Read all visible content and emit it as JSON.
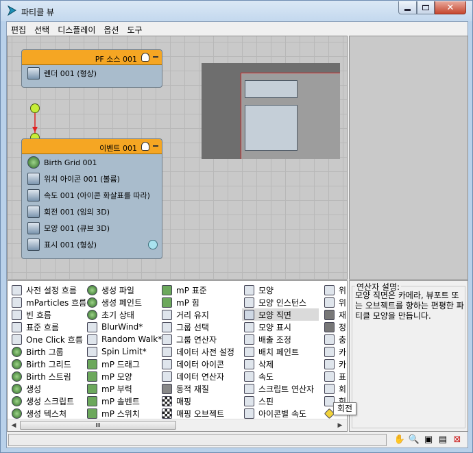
{
  "window": {
    "title": "파티클 뷰"
  },
  "menubar": [
    "편집",
    "선택",
    "디스플레이",
    "옵션",
    "도구"
  ],
  "nodes": [
    {
      "title": "PF 소스 001",
      "rows": [
        "렌더 001 (형상)"
      ]
    },
    {
      "title": "이벤트 001",
      "rows": [
        "Birth Grid 001",
        "위치 아이콘 001 (볼륨)",
        "속도 001 (아이콘 화살표를 따라)",
        "회전 001 (임의 3D)",
        "모양 001 (큐브 3D)",
        "표시 001 (형상)"
      ]
    }
  ],
  "depot": {
    "columns": [
      [
        "사전 설정 흐름",
        "mParticles 흐름",
        "빈 흐름",
        "표준 흐름",
        "One Click 흐름",
        "Birth 그룹",
        "Birth 그리드",
        "Birth 스트림",
        "생성",
        "생성 스크립트",
        "생성 텍스처"
      ],
      [
        "생성 파일",
        "생성 페인트",
        "초기 상태",
        "BlurWind*",
        "Random Walk*",
        "Spin Limit*",
        "mP 드래그",
        "mP 모양",
        "mP 부력",
        "mP 솔벤트",
        "mP 스위치"
      ],
      [
        "mP 표준",
        "mP 힘",
        "거리 유지",
        "그룹 선택",
        "그룹 연산자",
        "데이터 사전 설정",
        "데이터 아이콘",
        "데이터 연산자",
        "동적 재질",
        "매핑",
        "매핑 오브젝트"
      ],
      [
        "모양",
        "모양 인스턴스",
        "모양 직면",
        "모양 표시",
        "배출 조정",
        "배치 페인트",
        "삭제",
        "속도",
        "스크립트 연산자",
        "스핀",
        "아이콘별 속도"
      ],
      [
        "위",
        "위",
        "재",
        "정",
        "충",
        "카",
        "카",
        "표",
        "회",
        "힘",
        ""
      ]
    ],
    "selected": "모양 직면",
    "scroll_thumb_label": "III"
  },
  "description": {
    "title": "연산자 설명:",
    "text": "모양 직면은 카메라, 뷰포트 또는 오브젝트를 향하는 편평한 파티클 모양을 만듭니다."
  },
  "tooltip": "회전",
  "colors": {
    "event_header": "#f5a623",
    "node_body": "#a9bccc",
    "wire": "#e02020"
  }
}
